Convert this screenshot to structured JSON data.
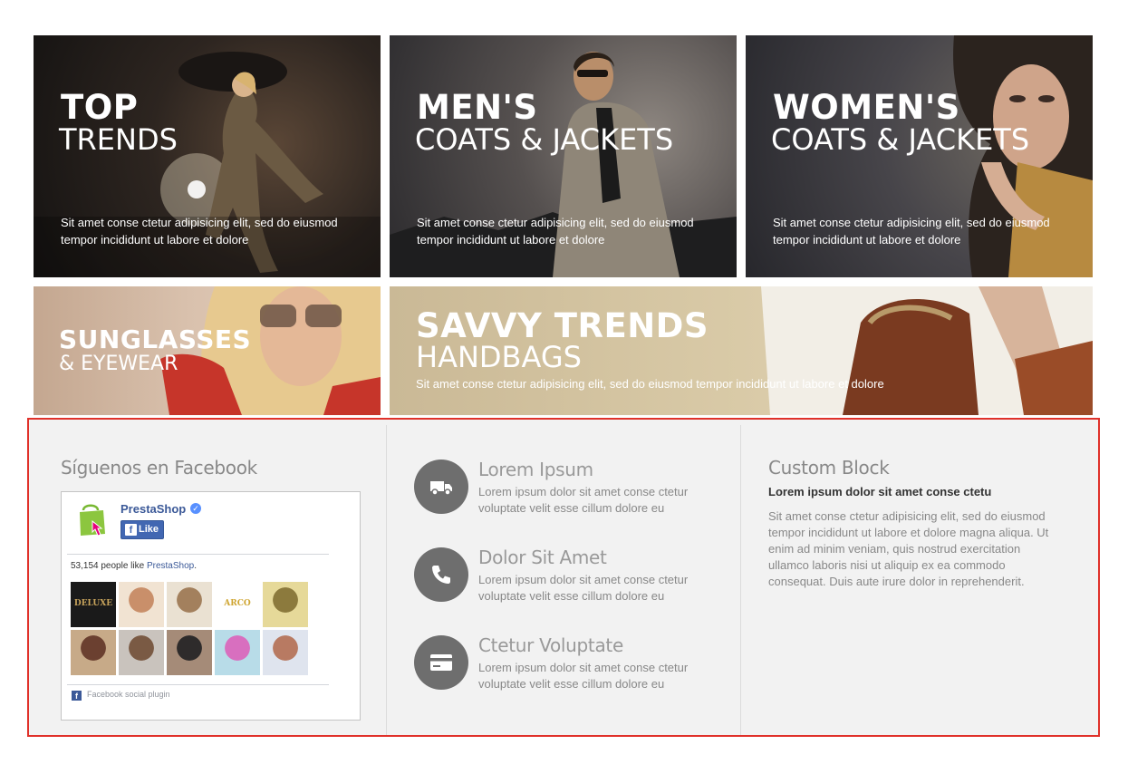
{
  "banners": [
    {
      "title_big": "TOP",
      "title_small": "TRENDS",
      "description": "Sit amet conse ctetur adipisicing elit, sed do eiusmod tempor incididunt ut labore et dolore"
    },
    {
      "title_big": "MEN'S",
      "title_small": "COATS & JACKETS",
      "description": "Sit amet conse ctetur adipisicing elit, sed do eiusmod tempor incididunt ut labore et dolore"
    },
    {
      "title_big": "WOMEN'S",
      "title_small": "COATS & JACKETS",
      "description": "Sit amet conse ctetur adipisicing elit, sed do eiusmod tempor incididunt ut labore et dolore"
    },
    {
      "title_big": "SUNGLASSES",
      "title_small": "& EYEWEAR"
    },
    {
      "title_big": "SAVVY TRENDS",
      "title_small": "HANDBAGS",
      "description": "Sit amet conse ctetur adipisicing elit, sed do eiusmod tempor incididunt ut labore et dolore"
    }
  ],
  "facebook": {
    "heading": "Síguenos en Facebook",
    "page_name": "PrestaShop",
    "verified_icon": "check-badge-icon",
    "like_label": "Like",
    "likes_count": "53,154",
    "likes_text": " people like ",
    "likes_link": "PrestaShop",
    "likes_suffix": ".",
    "faces": [
      {
        "label": "DELUXE",
        "colors": [
          "#1a1a1a",
          "#c9a55c"
        ]
      },
      {
        "colors": [
          "#c98f6a",
          "#f1e3d2"
        ]
      },
      {
        "colors": [
          "#a3805d",
          "#eae1d2"
        ]
      },
      {
        "label": "ARCO",
        "colors": [
          "#ffffff",
          "#cfa531"
        ]
      },
      {
        "colors": [
          "#8c7a3d",
          "#e6d999"
        ]
      },
      {
        "colors": [
          "#6b4030",
          "#c7aa88"
        ]
      },
      {
        "colors": [
          "#7a5a44",
          "#c9c3bd"
        ]
      },
      {
        "colors": [
          "#2e2b2b",
          "#a58b78"
        ]
      },
      {
        "colors": [
          "#d86fbf",
          "#b8dce8"
        ]
      },
      {
        "colors": [
          "#b87a62",
          "#dfe4ee"
        ]
      }
    ],
    "plugin_label": "Facebook social plugin"
  },
  "info_blocks": [
    {
      "icon": "truck-icon",
      "title": "Lorem Ipsum",
      "text": "Lorem ipsum dolor sit amet conse ctetur voluptate velit esse cillum dolore eu"
    },
    {
      "icon": "phone-icon",
      "title": "Dolor Sit Amet",
      "text": "Lorem ipsum dolor sit amet conse ctetur voluptate velit esse cillum dolore eu"
    },
    {
      "icon": "credit-card-icon",
      "title": "Ctetur Voluptate",
      "text": "Lorem ipsum dolor sit amet conse ctetur voluptate velit esse cillum dolore eu"
    }
  ],
  "custom_block": {
    "heading": "Custom Block",
    "subtitle": "Lorem ipsum dolor sit amet conse ctetu",
    "text": "Sit amet conse ctetur adipisicing elit, sed do eiusmod tempor incididunt ut labore et dolore magna aliqua. Ut enim ad minim veniam, quis nostrud exercitation ullamco laboris nisi ut aliquip ex ea commodo consequat. Duis aute irure dolor in reprehenderit."
  },
  "colors": {
    "highlight_border": "#e0312a",
    "footer_bg": "#f2f2f2",
    "icon_circle": "#6e6e6e",
    "facebook_blue": "#3b5998"
  }
}
